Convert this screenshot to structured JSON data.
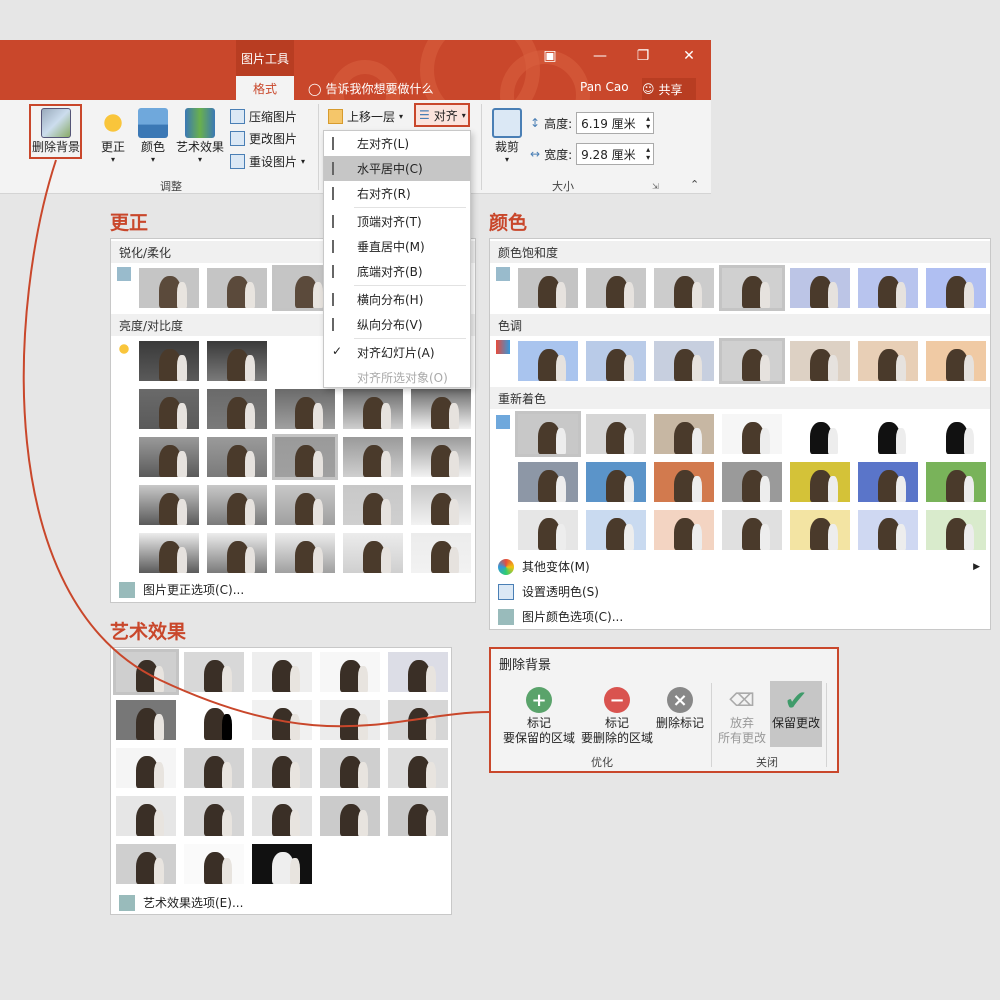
{
  "title_bar": {
    "context_tab": "图片工具",
    "active_tab": "格式",
    "tell_me": "告诉我你想要做什么",
    "user": "Pan Cao",
    "share": "共享"
  },
  "ribbon": {
    "remove_bg": "删除背景",
    "corrections": "更正",
    "color": "颜色",
    "artistic": "艺术效果",
    "compress": "压缩图片",
    "change": "更改图片",
    "reset": "重设图片",
    "adjust_group": "调整",
    "bring_forward": "上移一层",
    "align": "对齐",
    "crop": "裁剪",
    "height_label": "高度:",
    "height_value": "6.19 厘米",
    "width_label": "宽度:",
    "width_value": "9.28 厘米",
    "size_group": "大小"
  },
  "align_menu": [
    {
      "label": "左对齐(L)"
    },
    {
      "label": "水平居中(C)"
    },
    {
      "label": "右对齐(R)"
    },
    {
      "label": "顶端对齐(T)"
    },
    {
      "label": "垂直居中(M)"
    },
    {
      "label": "底端对齐(B)"
    },
    {
      "label": "横向分布(H)"
    },
    {
      "label": "纵向分布(V)"
    },
    {
      "label": "对齐幻灯片(A)"
    },
    {
      "label": "对齐所选对象(O)"
    }
  ],
  "corrections_panel": {
    "title": "更正",
    "sharpen": "锐化/柔化",
    "brightness": "亮度/对比度",
    "options": "图片更正选项(C)..."
  },
  "color_panel": {
    "title": "颜色",
    "saturation": "颜色饱和度",
    "tone": "色调",
    "recolor": "重新着色",
    "more": "其他变体(M)",
    "transparent": "设置透明色(S)",
    "options": "图片颜色选项(C)..."
  },
  "artistic_panel": {
    "title": "艺术效果",
    "options": "艺术效果选项(E)..."
  },
  "remove_bg_panel": {
    "title": "删除背景",
    "keep_1": "标记",
    "keep_2": "要保留的区域",
    "remove_1": "标记",
    "remove_2": "要删除的区域",
    "delete_mark": "删除标记",
    "discard_1": "放弃",
    "discard_2": "所有更改",
    "keep_changes": "保留更改",
    "refine_group": "优化",
    "close_group": "关闭"
  },
  "colors": {
    "accent": "#c9472b",
    "ribbon_bg": "#f3f3f3"
  }
}
